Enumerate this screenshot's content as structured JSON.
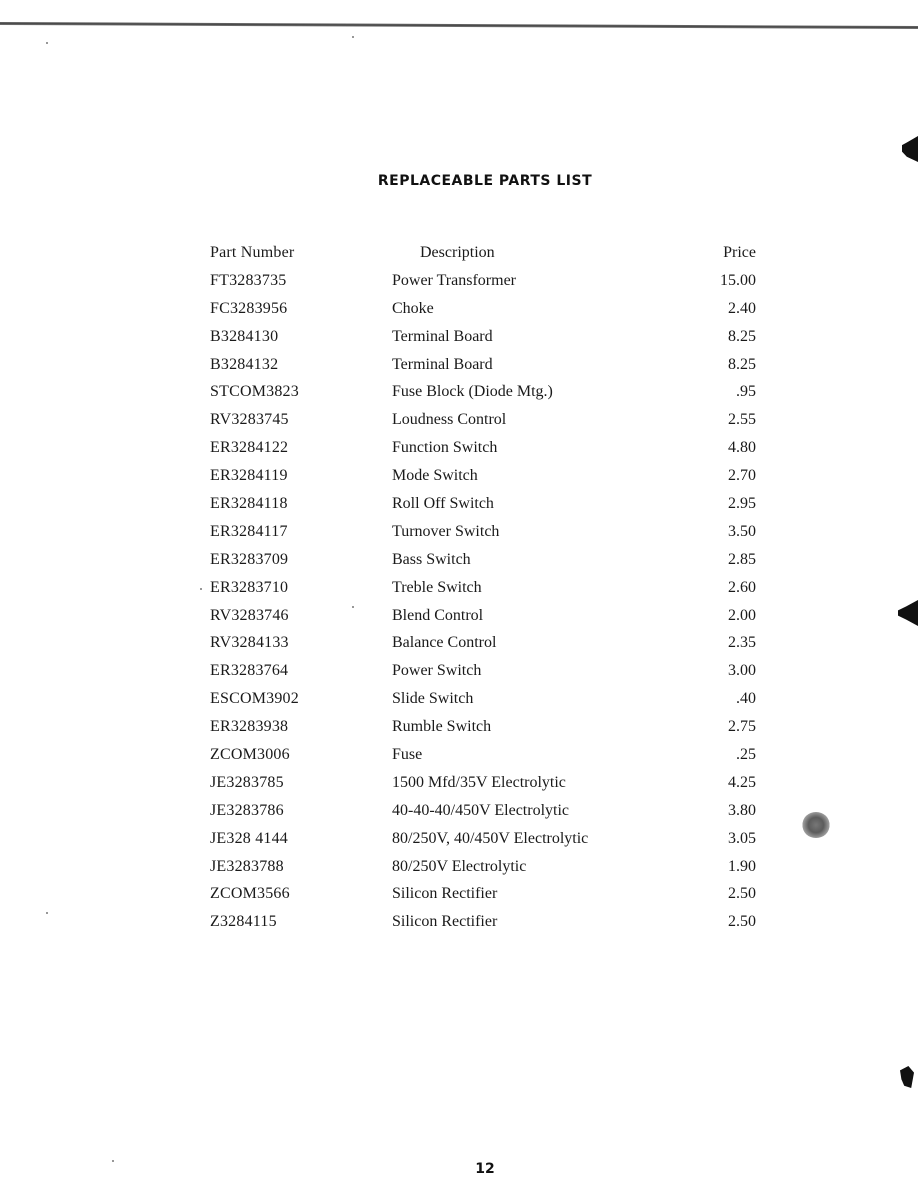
{
  "document": {
    "title": "REPLACEABLE PARTS LIST",
    "page_number": "12"
  },
  "table": {
    "headers": {
      "part_number": "Part Number",
      "description": "Description",
      "price": "Price"
    },
    "rows": [
      {
        "part_number": "FT3283735",
        "description": "Power Transformer",
        "price": "15.00"
      },
      {
        "part_number": "FC3283956",
        "description": "Choke",
        "price": "2.40"
      },
      {
        "part_number": "B3284130",
        "description": "Terminal Board",
        "price": "8.25"
      },
      {
        "part_number": "B3284132",
        "description": "Terminal Board",
        "price": "8.25"
      },
      {
        "part_number": "STCOM3823",
        "description": "Fuse Block (Diode Mtg.)",
        "price": ".95"
      },
      {
        "part_number": "RV3283745",
        "description": "Loudness Control",
        "price": "2.55"
      },
      {
        "part_number": "ER3284122",
        "description": "Function Switch",
        "price": "4.80"
      },
      {
        "part_number": "ER3284119",
        "description": "Mode Switch",
        "price": "2.70"
      },
      {
        "part_number": "ER3284118",
        "description": "Roll Off Switch",
        "price": "2.95"
      },
      {
        "part_number": "ER3284117",
        "description": "Turnover Switch",
        "price": "3.50"
      },
      {
        "part_number": "ER3283709",
        "description": "Bass Switch",
        "price": "2.85"
      },
      {
        "part_number": "ER3283710",
        "description": "Treble Switch",
        "price": "2.60"
      },
      {
        "part_number": "RV3283746",
        "description": "Blend Control",
        "price": "2.00"
      },
      {
        "part_number": "RV3284133",
        "description": "Balance Control",
        "price": "2.35"
      },
      {
        "part_number": "ER3283764",
        "description": "Power Switch",
        "price": "3.00"
      },
      {
        "part_number": "ESCOM3902",
        "description": "Slide Switch",
        "price": ".40"
      },
      {
        "part_number": "ER3283938",
        "description": "Rumble Switch",
        "price": "2.75"
      },
      {
        "part_number": "ZCOM3006",
        "description": "Fuse",
        "price": ".25"
      },
      {
        "part_number": "JE3283785",
        "description": "1500 Mfd/35V Electrolytic",
        "price": "4.25"
      },
      {
        "part_number": "JE3283786",
        "description": "40-40-40/450V Electrolytic",
        "price": "3.80"
      },
      {
        "part_number": "JE328 4144",
        "description": "80/250V, 40/450V Electrolytic",
        "price": "3.05"
      },
      {
        "part_number": "JE3283788",
        "description": "80/250V Electrolytic",
        "price": "1.90"
      },
      {
        "part_number": "ZCOM3566",
        "description": "Silicon Rectifier",
        "price": "2.50"
      },
      {
        "part_number": "Z3284115",
        "description": "Silicon Rectifier",
        "price": "2.50"
      }
    ]
  }
}
